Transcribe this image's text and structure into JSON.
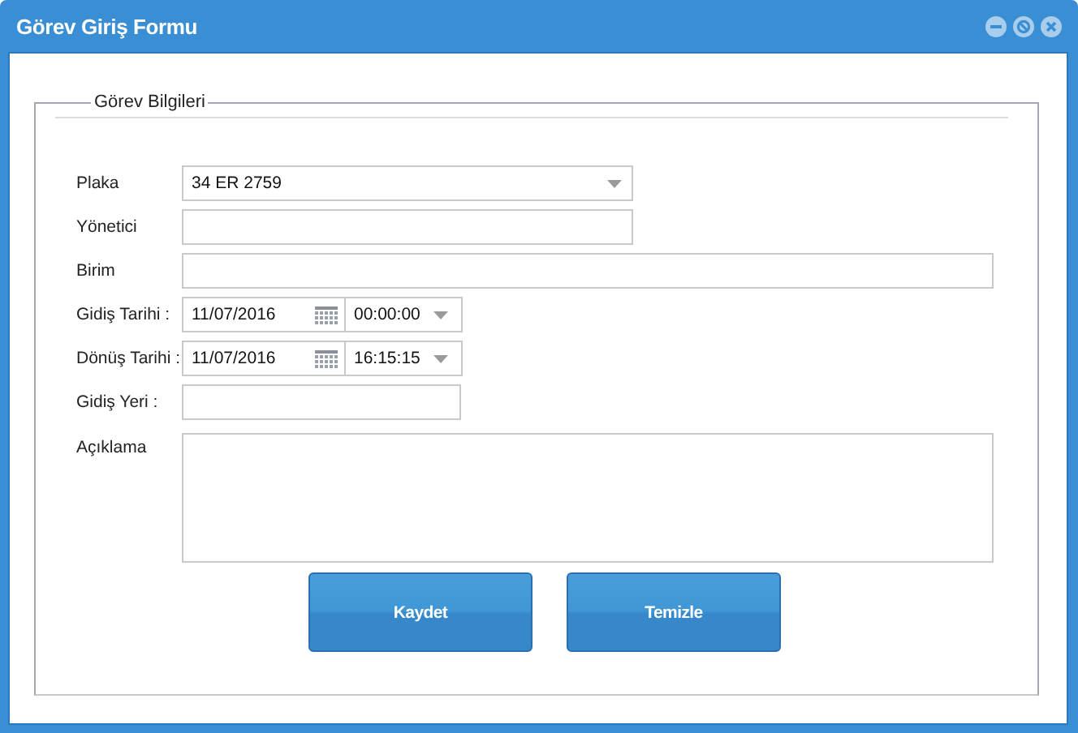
{
  "window": {
    "title": "Görev Giriş Formu"
  },
  "group": {
    "legend": "Görev Bilgileri"
  },
  "fields": [
    {
      "kind": "select",
      "label": "Plaka",
      "value": "34 ER 2759"
    },
    {
      "kind": "text",
      "label": "Yönetici"
    },
    {
      "kind": "text",
      "label": "Birim"
    },
    {
      "kind": "datetime",
      "label": "Gidiş Tarihi :",
      "date": "11/07/2016",
      "time": "00:00:00"
    },
    {
      "kind": "datetime",
      "label": "Dönüş Tarihi :",
      "date": "11/07/2016",
      "time": "16:15:15"
    },
    {
      "kind": "text",
      "label": "Gidiş Yeri :"
    },
    {
      "kind": "textarea",
      "label": "Açıklama"
    }
  ],
  "buttons": [
    {
      "label": "Kaydet"
    },
    {
      "label": "Temizle"
    }
  ]
}
